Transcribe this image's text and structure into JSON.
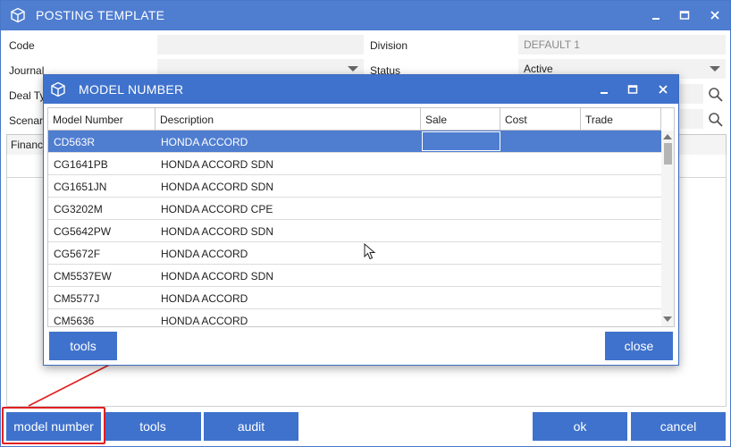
{
  "window": {
    "title": "POSTING TEMPLATE",
    "icon": "cube-icon",
    "controls": [
      "minimize-icon",
      "maximize-icon",
      "close-icon"
    ]
  },
  "form": {
    "code_label": "Code",
    "code_value": "",
    "journal_label": "Journal",
    "journal_value": "",
    "deal_type_label": "Deal Ty",
    "scenario_label": "Scenari",
    "division_label": "Division",
    "division_value": "DEFAULT 1",
    "status_label": "Status",
    "status_value": "Active"
  },
  "tabs": [
    "Finance"
  ],
  "footer": {
    "model_number_label": "model number",
    "tools_label": "tools",
    "audit_label": "audit",
    "ok_label": "ok",
    "cancel_label": "cancel"
  },
  "modal": {
    "title": "MODEL NUMBER",
    "icon": "cube-icon",
    "columns": [
      "Model Number",
      "Description",
      "Sale",
      "Cost",
      "Trade"
    ],
    "rows": [
      {
        "model": "CD563R",
        "description": "HONDA ACCORD",
        "sale": "",
        "cost": "",
        "trade": ""
      },
      {
        "model": "CG1641PB",
        "description": "HONDA ACCORD SDN",
        "sale": "",
        "cost": "",
        "trade": ""
      },
      {
        "model": "CG1651JN",
        "description": "HONDA ACCORD SDN",
        "sale": "",
        "cost": "",
        "trade": ""
      },
      {
        "model": "CG3202M",
        "description": "HONDA ACCORD CPE",
        "sale": "",
        "cost": "",
        "trade": ""
      },
      {
        "model": "CG5642PW",
        "description": "HONDA ACCORD SDN",
        "sale": "",
        "cost": "",
        "trade": ""
      },
      {
        "model": "CG5672F",
        "description": "HONDA ACCORD",
        "sale": "",
        "cost": "",
        "trade": ""
      },
      {
        "model": "CM5537EW",
        "description": "HONDA ACCORD SDN",
        "sale": "",
        "cost": "",
        "trade": ""
      },
      {
        "model": "CM5577J",
        "description": "HONDA ACCORD",
        "sale": "",
        "cost": "",
        "trade": ""
      },
      {
        "model": "CM5636",
        "description": "HONDA ACCORD",
        "sale": "",
        "cost": "",
        "trade": ""
      }
    ],
    "selected_row": 0,
    "tools_label": "tools",
    "close_label": "close"
  },
  "colors": {
    "titlebar": "#4f7dd0",
    "button": "#3f72cc",
    "selection": "#4f7dd0",
    "annotation": "#e02020"
  }
}
